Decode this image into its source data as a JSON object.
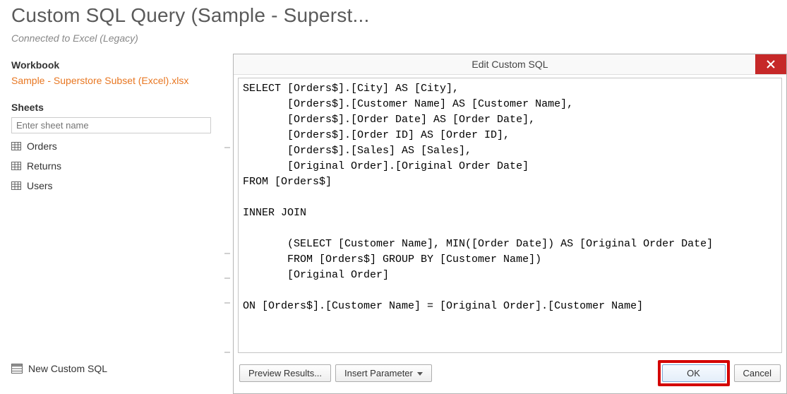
{
  "header": {
    "title": "Custom SQL Query (Sample - Superst...",
    "subtitle": "Connected to Excel (Legacy)"
  },
  "sidebar": {
    "workbook_label": "Workbook",
    "workbook_name": "Sample - Superstore Subset (Excel).xlsx",
    "sheets_label": "Sheets",
    "sheet_input_placeholder": "Enter sheet name",
    "sheets": [
      {
        "name": "Orders"
      },
      {
        "name": "Returns"
      },
      {
        "name": "Users"
      }
    ],
    "new_custom_sql_label": "New Custom SQL"
  },
  "dialog": {
    "title": "Edit Custom SQL",
    "sql_text": "SELECT [Orders$].[City] AS [City],\n       [Orders$].[Customer Name] AS [Customer Name],\n       [Orders$].[Order Date] AS [Order Date],\n       [Orders$].[Order ID] AS [Order ID],\n       [Orders$].[Sales] AS [Sales],\n       [Original Order].[Original Order Date]\nFROM [Orders$]\n\nINNER JOIN\n\n       (SELECT [Customer Name], MIN([Order Date]) AS [Original Order Date]\n       FROM [Orders$] GROUP BY [Customer Name])\n       [Original Order]\n\nON [Orders$].[Customer Name] = [Original Order].[Customer Name]",
    "buttons": {
      "preview_results": "Preview Results...",
      "insert_parameter": "Insert Parameter",
      "ok": "OK",
      "cancel": "Cancel"
    }
  }
}
